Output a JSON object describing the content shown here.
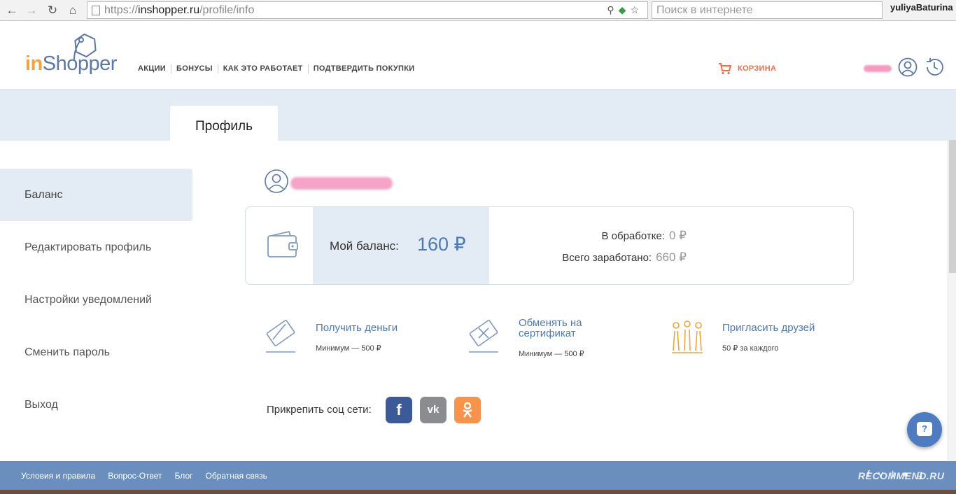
{
  "browser": {
    "url_prefix": "https://",
    "url_host": "inshopper.ru",
    "url_path": "/profile/info",
    "search_placeholder": "Поиск в интернете",
    "user": "yuliyaBaturina"
  },
  "header": {
    "logo_in": "in",
    "logo_rest": "Shopper",
    "nav": [
      "АКЦИИ",
      "БОНУСЫ",
      "КАК ЭТО РАБОТАЕТ",
      "ПОДТВЕРДИТЬ ПОКУПКИ"
    ],
    "cart_label": "КОРЗИНА"
  },
  "tabs": {
    "active": "Профиль"
  },
  "sidebar": {
    "items": [
      {
        "label": "Баланс",
        "active": true
      },
      {
        "label": "Редактировать профиль"
      },
      {
        "label": "Настройки уведомлений"
      },
      {
        "label": "Сменить пароль"
      },
      {
        "label": "Выход"
      }
    ]
  },
  "balance": {
    "label": "Мой баланс:",
    "value": "160 ₽",
    "processing_label": "В обработке:",
    "processing_value": "0 ₽",
    "earned_label": "Всего заработано:",
    "earned_value": "660 ₽"
  },
  "actions": [
    {
      "title": "Получить деньги",
      "subtitle": "Минимум — 500 ₽",
      "icon": "card-icon"
    },
    {
      "title": "Обменять на сертификат",
      "subtitle": "Минимум — 500 ₽",
      "icon": "gift-card-icon"
    },
    {
      "title": "Пригласить друзей",
      "subtitle": "50 ₽ за каждого",
      "icon": "friends-icon"
    }
  ],
  "social": {
    "label": "Прикрепить соц сети:",
    "buttons": [
      {
        "name": "facebook",
        "glyph": "f",
        "color": "#3d5a98"
      },
      {
        "name": "vk",
        "glyph": "vk",
        "color": "#8a8c8f"
      },
      {
        "name": "odnoklassniki",
        "glyph": "ok",
        "color": "#f7934a"
      }
    ]
  },
  "help": {
    "glyph": "?"
  },
  "footer": {
    "links": [
      "Условия и правила",
      "Вопрос-Ответ",
      "Блог",
      "Обратная связь"
    ],
    "watermark": "RECOMMEND.RU"
  },
  "colors": {
    "accent_blue": "#4d79b5",
    "light_panel": "#e3ebf5",
    "footer": "#6a8fbf",
    "cart": "#e96f48",
    "logo_orange": "#f0a43a"
  }
}
